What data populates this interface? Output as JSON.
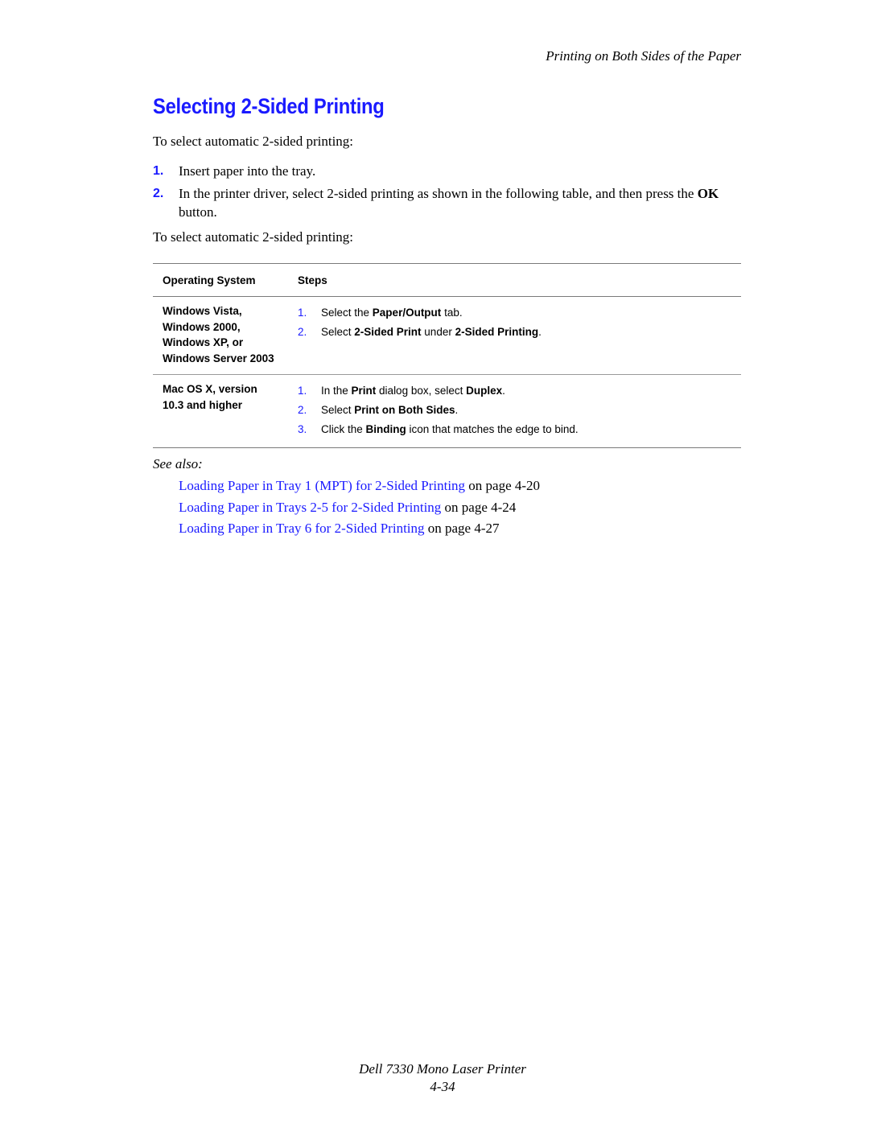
{
  "running_head": "Printing on Both Sides of the Paper",
  "title": "Selecting 2-Sided Printing",
  "intro": "To select automatic 2-sided printing:",
  "steps": [
    {
      "num": "1.",
      "text": "Insert paper into the tray."
    },
    {
      "num": "2.",
      "text_before": "In the printer driver, select 2-sided printing as shown in the following table, and then press the ",
      "bold": "OK",
      "text_after": " button."
    }
  ],
  "intro2": "To select automatic 2-sided printing:",
  "table": {
    "headers": {
      "os": "Operating System",
      "steps": "Steps"
    },
    "rows": [
      {
        "os_lines": [
          "Windows Vista,",
          "Windows 2000,",
          "Windows XP, or",
          "Windows Server 2003"
        ],
        "steps": [
          {
            "num": "1.",
            "parts": [
              "Select the ",
              "Paper/Output",
              " tab."
            ]
          },
          {
            "num": "2.",
            "parts": [
              "Select ",
              "2-Sided Print",
              " under ",
              "2-Sided Printing",
              "."
            ]
          }
        ]
      },
      {
        "os_lines": [
          "Mac OS X, version",
          "10.3 and higher"
        ],
        "steps": [
          {
            "num": "1.",
            "parts": [
              "In the ",
              "Print",
              " dialog box, select ",
              "Duplex",
              "."
            ]
          },
          {
            "num": "2.",
            "parts": [
              "Select ",
              "Print on Both Sides",
              "."
            ]
          },
          {
            "num": "3.",
            "parts": [
              "Click the ",
              "Binding",
              " icon that matches the edge to bind."
            ]
          }
        ]
      }
    ]
  },
  "see_also": {
    "label": "See also:",
    "links": [
      {
        "link": "Loading Paper in Tray 1 (MPT) for 2-Sided Printing",
        "suffix": " on page 4-20"
      },
      {
        "link": "Loading Paper in Trays 2-5 for 2-Sided Printing",
        "suffix": " on page 4-24"
      },
      {
        "link": "Loading Paper in Tray 6 for 2-Sided Printing",
        "suffix": " on page 4-27"
      }
    ]
  },
  "footer": {
    "product": "Dell 7330 Mono Laser Printer",
    "page": "4-34"
  },
  "colors": {
    "accent": "#1a1aff",
    "text": "#000000",
    "rule": "#7a7a7a"
  }
}
